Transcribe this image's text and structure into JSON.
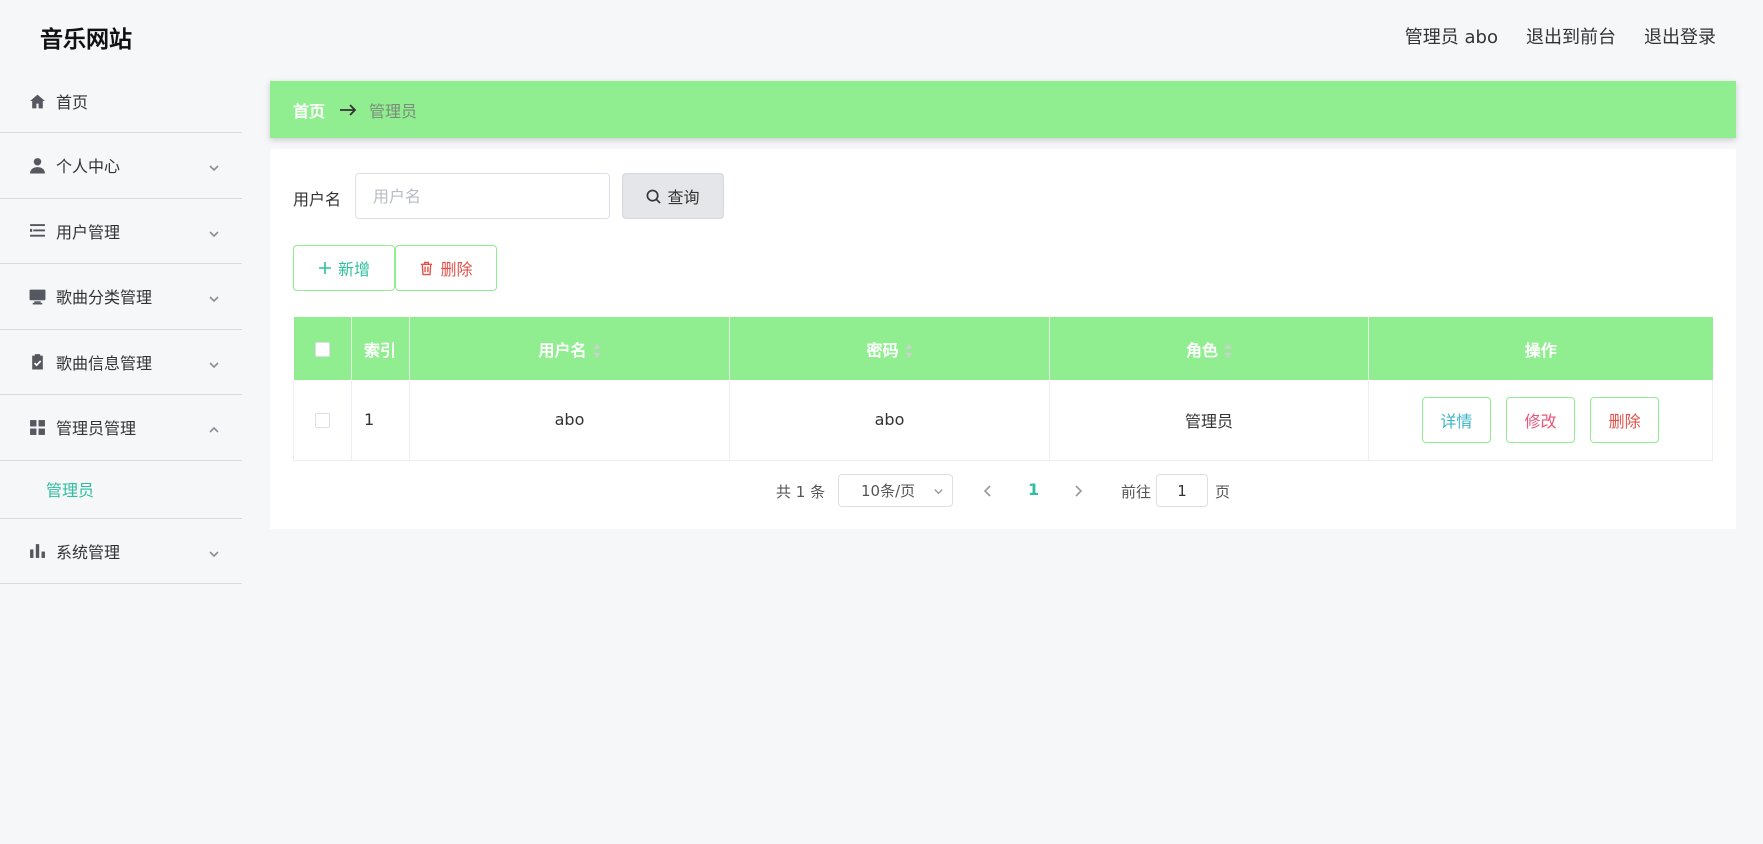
{
  "header": {
    "site_title": "音乐网站",
    "admin_label": "管理员 abo",
    "to_front": "退出到前台",
    "logout": "退出登录"
  },
  "sidebar": {
    "items": [
      {
        "label": "首页",
        "icon": "home-icon"
      },
      {
        "label": "个人中心",
        "icon": "user-icon"
      },
      {
        "label": "用户管理",
        "icon": "list-icon"
      },
      {
        "label": "歌曲分类管理",
        "icon": "monitor-icon"
      },
      {
        "label": "歌曲信息管理",
        "icon": "clipboard-icon"
      },
      {
        "label": "管理员管理",
        "icon": "grid-icon"
      },
      {
        "label": "系统管理",
        "icon": "bar-chart-icon"
      }
    ],
    "submenu_admin": "管理员"
  },
  "breadcrumb": {
    "home": "首页",
    "current": "管理员"
  },
  "search": {
    "label": "用户名",
    "placeholder": "用户名",
    "button": "查询"
  },
  "actions": {
    "add": "新增",
    "delete": "删除"
  },
  "table": {
    "headers": {
      "index": "索引",
      "username": "用户名",
      "password": "密码",
      "role": "角色",
      "operation": "操作"
    },
    "rows": [
      {
        "index": "1",
        "username": "abo",
        "password": "abo",
        "role": "管理员"
      }
    ],
    "op_detail": "详情",
    "op_edit": "修改",
    "op_delete": "删除"
  },
  "pagination": {
    "total": "共 1 条",
    "page_size": "10条/页",
    "current_page": "1",
    "goto_label": "前往",
    "goto_value": "1",
    "page_unit": "页"
  },
  "colors": {
    "accent_green": "#90ee90",
    "primary_teal": "#2fbfa0",
    "danger_red": "#e0524a"
  }
}
